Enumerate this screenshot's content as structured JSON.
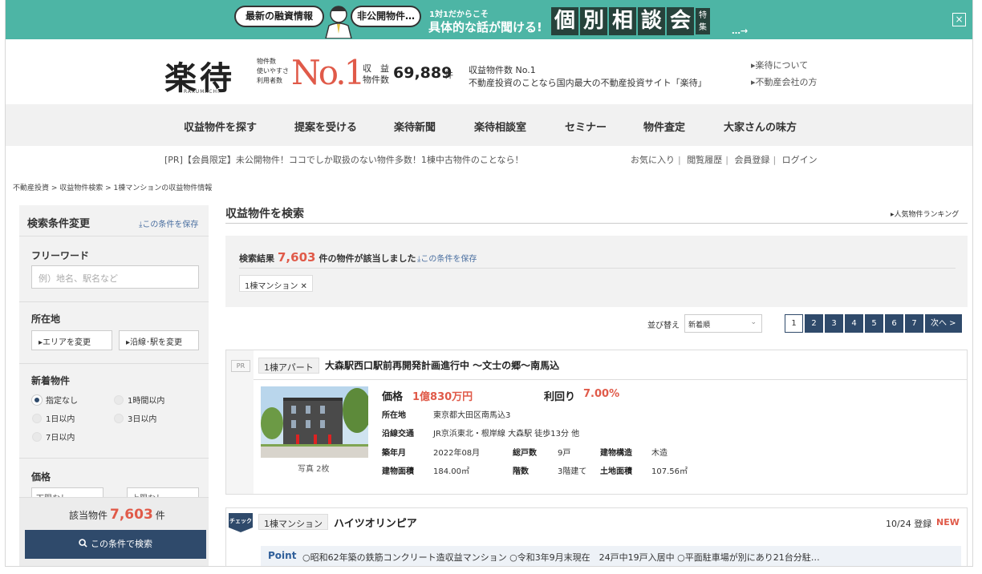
{
  "banner": {
    "bubble1": "最新の融資情報",
    "bubble2": "非公開物件…",
    "sub1": "1対1だからこそ",
    "sub2": "具体的な話が聞ける!",
    "big_chars": [
      "個",
      "別",
      "相",
      "談",
      "会"
    ],
    "toku": "特集",
    "arrow": "…→",
    "close": "×"
  },
  "header": {
    "logo": "楽待",
    "logo_sub": "RAKUMACHI",
    "no1_small": [
      "物件数",
      "使いやすさ",
      "利用者数"
    ],
    "no1_big": "No.1",
    "count_label1": "収　益",
    "count_label2": "物件数",
    "count_value": "69,889",
    "count_unit": "件",
    "desc1": "収益物件数 No.1",
    "desc2": "不動産投資のことなら国内最大の不動産投資サイト「楽待」",
    "link1": "▸楽待について",
    "link2": "▸不動産会社の方"
  },
  "nav": [
    "収益物件を探す",
    "提案を受ける",
    "楽待新聞",
    "楽待相談室",
    "セミナー",
    "物件査定",
    "大家さんの味方"
  ],
  "notice": "[PR]【会員限定】未公開物件！ココでしか取扱のない物件多数！1棟中古物件のことなら！",
  "userlinks": [
    "お気に入り",
    "閲覧履歴",
    "会員登録",
    "ログイン"
  ],
  "breadcrumb": "不動産投資 > 収益物件検索 > 1棟マンションの収益物件情報",
  "sidebar": {
    "title": "検索条件変更",
    "save": "⤓この条件を保存",
    "freeword_label": "フリーワード",
    "freeword_placeholder": "例）地名、駅名など",
    "location_label": "所在地",
    "area_btn": "▸エリアを変更",
    "line_btn": "▸沿線･駅を変更",
    "new_label": "新着物件",
    "radios": [
      "指定なし",
      "1時間以内",
      "1日以内",
      "3日以内",
      "7日以内"
    ],
    "price_label": "価格",
    "price_min": "下限なし",
    "price_max": "上限なし",
    "count_label": "該当物件",
    "count_value": "7,603",
    "count_unit": "件",
    "search_btn": "この条件で検索"
  },
  "main": {
    "title": "収益物件を検索",
    "ranking": "▸人気物件ランキング",
    "result_prefix": "検索結果",
    "result_count": "7,603",
    "result_suffix": "件の物件が該当しました",
    "result_save": "⤓この条件を保存",
    "filter_tag": "1棟マンション ✕",
    "sort_label": "並び替え",
    "sort_value": "新着順",
    "pages": [
      "1",
      "2",
      "3",
      "4",
      "5",
      "6",
      "7"
    ],
    "next": "次へ >"
  },
  "listing1": {
    "pr": "PR",
    "type": "1棟アパート",
    "title": "大森駅西口駅前再開発計画進行中 ～文士の郷～南馬込",
    "photo_caption": "写真 2枚",
    "price_label": "価格",
    "price_value": "1億830万円",
    "yield_label": "利回り",
    "yield_value": "7.00%",
    "address_label": "所在地",
    "address": "東京都大田区南馬込3",
    "transit_label": "沿線交通",
    "transit": "JR京浜東北・根岸線 大森駅 徒歩13分 他",
    "built_label": "築年月",
    "built": "2022年08月",
    "units_label": "総戸数",
    "units": "9戸",
    "structure_label": "建物構造",
    "structure": "木造",
    "area_label": "建物面積",
    "area": "184.00㎡",
    "floors_label": "階数",
    "floors": "3階建て",
    "land_label": "土地面積",
    "land": "107.56㎡"
  },
  "listing2": {
    "check": "チェック",
    "type": "1棟マンション",
    "title": "ハイツオリンピア",
    "date": "10/24 登録",
    "new": "NEW",
    "point_label": "Point",
    "point_text": "○昭和62年築の鉄筋コンクリート造収益マンション ○令和3年9月末現在　24戸中19戸入居中 ○平面駐車場が別にあり21台分駐…"
  },
  "colors": {
    "banner": "#4db5a5",
    "accent_red": "#e05a49",
    "navy": "#2f4a6b"
  }
}
